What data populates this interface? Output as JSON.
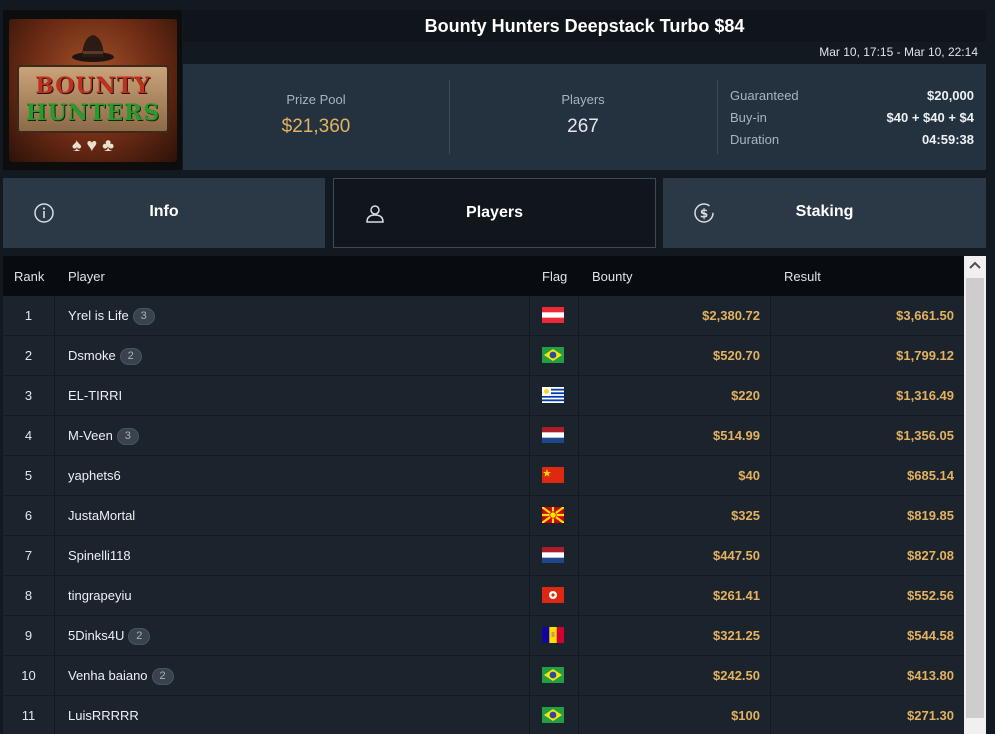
{
  "header": {
    "logo_text": [
      "BOUNTY",
      "HUNTERS"
    ],
    "title": "Bounty Hunters Deepstack Turbo $84",
    "dates": "Mar 10, 17:15 - Mar 10, 22:14"
  },
  "stats": {
    "prize_pool_label": "Prize Pool",
    "prize_pool_value": "$21,360",
    "players_label": "Players",
    "players_value": "267",
    "details": [
      {
        "label": "Guaranteed",
        "value": "$20,000"
      },
      {
        "label": "Buy-in",
        "value": "$40 + $40 + $4"
      },
      {
        "label": "Duration",
        "value": "04:59:38"
      }
    ]
  },
  "tabs": [
    {
      "label": "Info",
      "icon": "info-icon",
      "active": false
    },
    {
      "label": "Players",
      "icon": "user-icon",
      "active": true
    },
    {
      "label": "Staking",
      "icon": "dollar-coin-icon",
      "active": false
    }
  ],
  "table": {
    "columns": {
      "rank": "Rank",
      "player": "Player",
      "flag": "Flag",
      "bounty": "Bounty",
      "result": "Result"
    },
    "rows": [
      {
        "rank": "1",
        "player": "Yrel is Life",
        "badge": "3",
        "flag": "austria",
        "bounty": "$2,380.72",
        "result": "$3,661.50"
      },
      {
        "rank": "2",
        "player": "Dsmoke",
        "badge": "2",
        "flag": "brazil",
        "bounty": "$520.70",
        "result": "$1,799.12"
      },
      {
        "rank": "3",
        "player": "EL-TIRRI",
        "badge": "",
        "flag": "uruguay",
        "bounty": "$220",
        "result": "$1,316.49"
      },
      {
        "rank": "4",
        "player": "M-Veen",
        "badge": "3",
        "flag": "netherlands",
        "bounty": "$514.99",
        "result": "$1,356.05"
      },
      {
        "rank": "5",
        "player": "yaphets6",
        "badge": "",
        "flag": "china",
        "bounty": "$40",
        "result": "$685.14"
      },
      {
        "rank": "6",
        "player": "JustaMortal",
        "badge": "",
        "flag": "north-macedonia",
        "bounty": "$325",
        "result": "$819.85"
      },
      {
        "rank": "7",
        "player": "Spinelli118",
        "badge": "",
        "flag": "netherlands",
        "bounty": "$447.50",
        "result": "$827.08"
      },
      {
        "rank": "8",
        "player": "tingrapeyiu",
        "badge": "",
        "flag": "hong-kong",
        "bounty": "$261.41",
        "result": "$552.56"
      },
      {
        "rank": "9",
        "player": "5Dinks4U",
        "badge": "2",
        "flag": "andorra",
        "bounty": "$321.25",
        "result": "$544.58"
      },
      {
        "rank": "10",
        "player": "Venha baiano",
        "badge": "2",
        "flag": "brazil",
        "bounty": "$242.50",
        "result": "$413.80"
      },
      {
        "rank": "11",
        "player": "LuisRRRRR",
        "badge": "",
        "flag": "brazil",
        "bounty": "$100",
        "result": "$271.30"
      }
    ]
  }
}
